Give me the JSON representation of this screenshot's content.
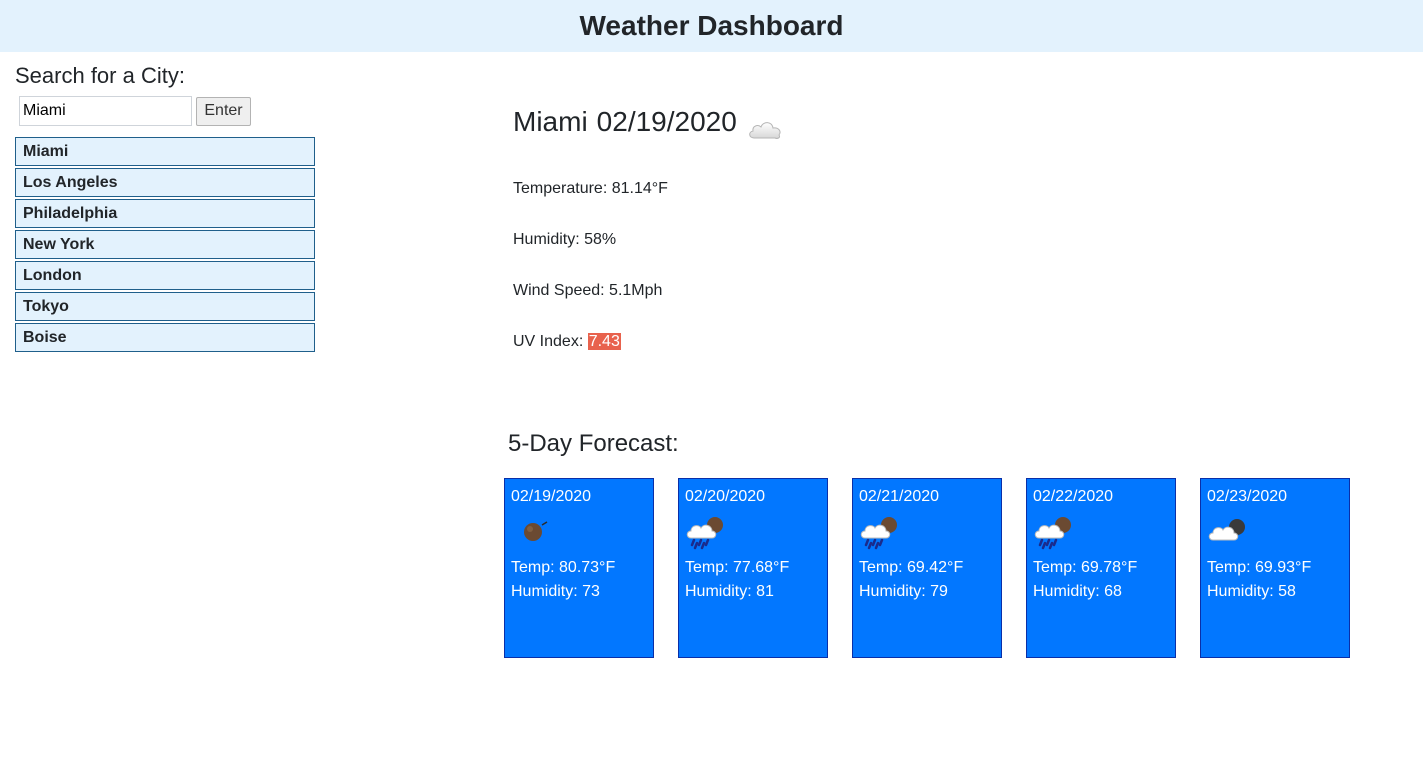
{
  "header": {
    "title": "Weather Dashboard"
  },
  "search": {
    "heading": "Search for a City:",
    "input_value": "Miami",
    "button_label": "Enter"
  },
  "cities": [
    "Miami",
    "Los Angeles",
    "Philadelphia",
    "New York",
    "London",
    "Tokyo",
    "Boise"
  ],
  "current": {
    "city": "Miami",
    "date": "02/19/2020",
    "icon": "cloud-icon",
    "temperature": "Temperature: 81.14°F",
    "humidity": "Humidity: 58%",
    "wind": "Wind Speed: 5.1Mph",
    "uv_label": "UV Index: ",
    "uv_value": "7.43",
    "uv_color": "#e8624d"
  },
  "forecast": {
    "heading": "5-Day Forecast:",
    "days": [
      {
        "date": "02/19/2020",
        "icon": "dark-moon-icon",
        "temp": "Temp: 80.73°F",
        "humidity": "Humidity: 73"
      },
      {
        "date": "02/20/2020",
        "icon": "rain-cloud-icon",
        "temp": "Temp: 77.68°F",
        "humidity": "Humidity: 81"
      },
      {
        "date": "02/21/2020",
        "icon": "rain-cloud-icon",
        "temp": "Temp: 69.42°F",
        "humidity": "Humidity: 79"
      },
      {
        "date": "02/22/2020",
        "icon": "rain-cloud-icon",
        "temp": "Temp: 69.78°F",
        "humidity": "Humidity: 68"
      },
      {
        "date": "02/23/2020",
        "icon": "cloud-moon-icon",
        "temp": "Temp: 69.93°F",
        "humidity": "Humidity: 58"
      }
    ],
    "card_color": "#0277ff"
  }
}
